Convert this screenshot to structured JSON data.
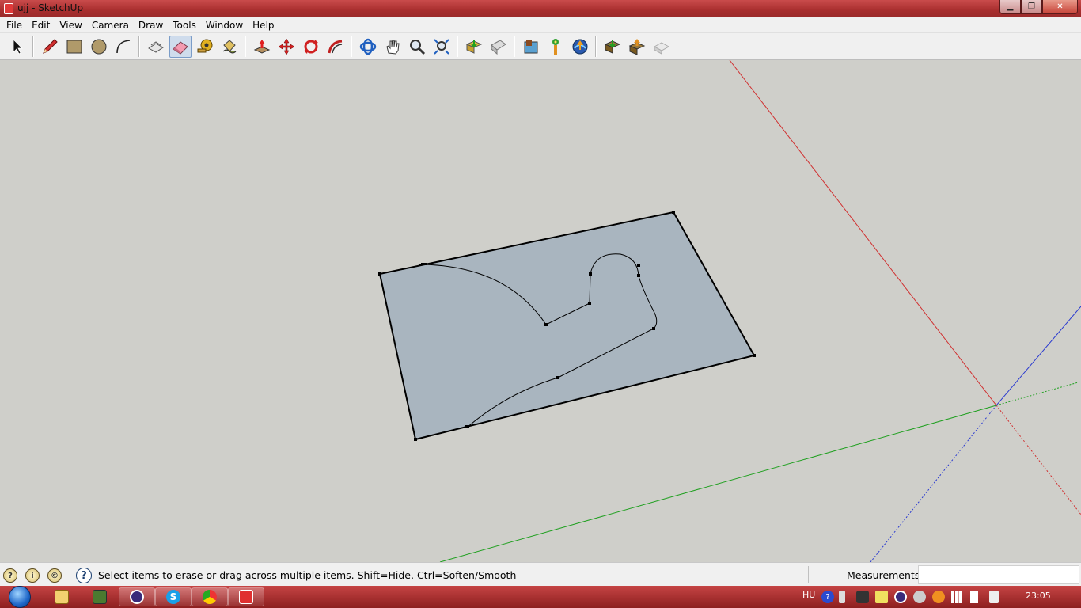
{
  "window": {
    "title": "ujj - SketchUp",
    "minimize_glyph": "▁",
    "maximize_glyph": "❐",
    "close_glyph": "✕"
  },
  "menu": [
    "File",
    "Edit",
    "View",
    "Camera",
    "Draw",
    "Tools",
    "Window",
    "Help"
  ],
  "toolbar": {
    "groups": [
      [
        "select-icon"
      ],
      [
        "pencil-icon",
        "rectangle-icon",
        "circle-icon",
        "arc-icon"
      ],
      [
        "make-component-icon",
        "eraser-icon",
        "tape-measure-icon",
        "paint-bucket-icon"
      ],
      [
        "push-pull-icon",
        "move-icon",
        "rotate-icon",
        "follow-me-icon"
      ],
      [
        "orbit-icon",
        "pan-icon",
        "zoom-icon",
        "zoom-extents-icon"
      ],
      [
        "get-models-icon",
        "share-model-icon"
      ],
      [
        "get-current-view-icon",
        "toggle-terrain-icon",
        "add-location-icon"
      ],
      [
        "get-components-icon",
        "share-component-icon",
        "preview-google-earth-icon"
      ]
    ],
    "active_tool": "eraser-icon"
  },
  "statusbar": {
    "hint": "Select items to erase or drag across multiple items. Shift=Hide, Ctrl=Soften/Smooth",
    "help_glyph": "?",
    "icons": [
      "geo-location-icon",
      "credits-icon",
      "copyright-icon"
    ],
    "measurements_label": "Measurements",
    "measurements_value": ""
  },
  "taskbar": {
    "apps": [
      "file-explorer-icon",
      "minecraft-icon",
      "eclipse-icon",
      "skype-icon",
      "chrome-icon",
      "sketchup-icon"
    ],
    "language": "HU",
    "clock": "23:05"
  },
  "colors": {
    "title_bar": "#a82e2e",
    "taskbar": "#8d1f1f",
    "viewport_background": "#cfcfca",
    "face_fill": "#a9b5bf",
    "red_axis": "#d03030",
    "green_axis": "#20a020",
    "blue_axis": "#2a3ad0"
  }
}
